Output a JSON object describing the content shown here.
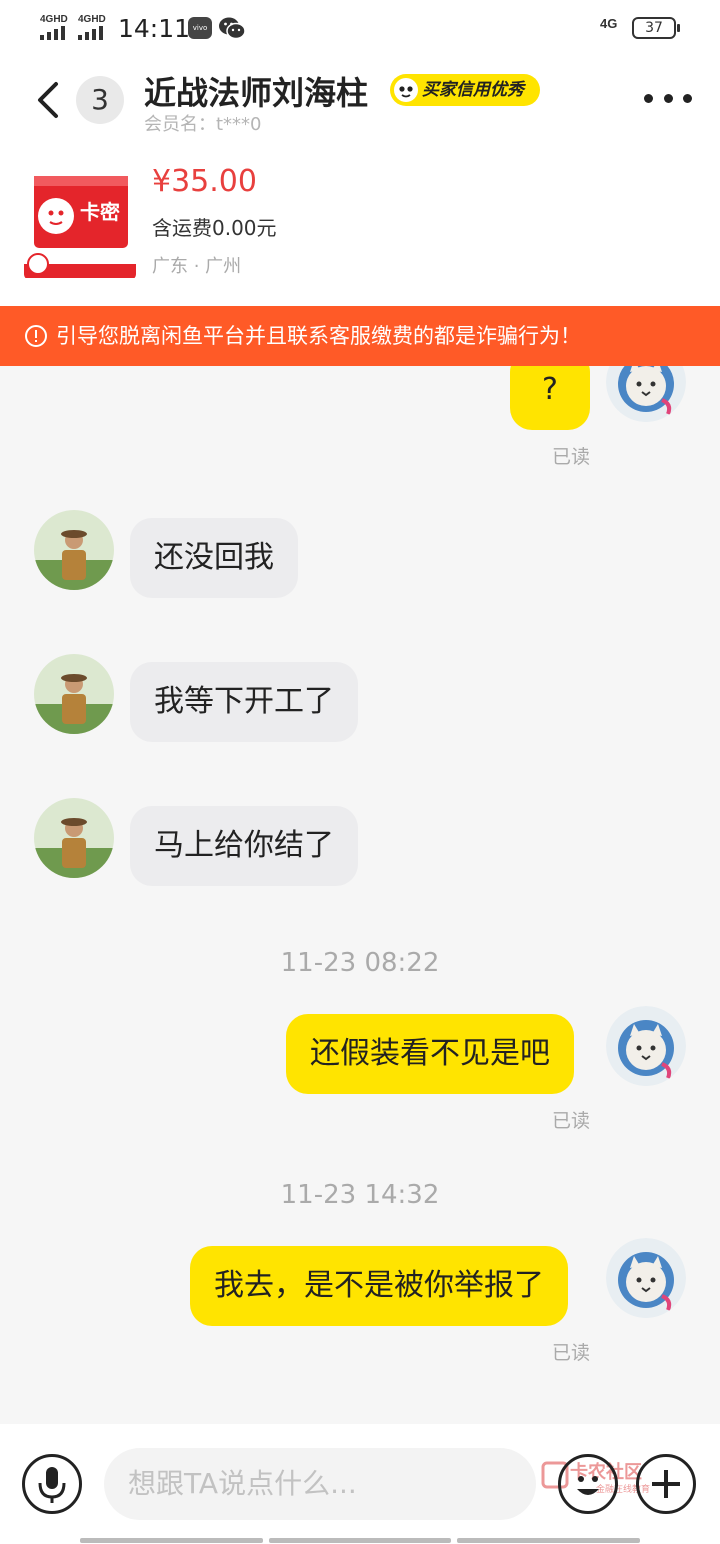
{
  "status_bar": {
    "signal_1": "4GHD",
    "signal_2": "4GHD",
    "time": "14:11",
    "network": "4G",
    "battery": "37"
  },
  "header": {
    "unread_count": "3",
    "title": "近战法师刘海柱",
    "credit_badge": "买家信用优秀",
    "member_name": "会员名：t***0"
  },
  "product": {
    "image_text": "卡密",
    "price": "¥35.00",
    "shipping": "含运费0.00元",
    "location": "广东 · 广州"
  },
  "warning": {
    "text": "引导您脱离闲鱼平台并且联系客服缴费的都是诈骗行为！"
  },
  "messages": {
    "m1": {
      "text": "?",
      "status": "已读"
    },
    "m2": {
      "text": "还没回我"
    },
    "m3": {
      "text": "我等下开工了"
    },
    "m4": {
      "text": "马上给你结了"
    },
    "t1": "11-23 08:22",
    "m5": {
      "text": "还假装看不见是吧",
      "status": "已读"
    },
    "t2": "11-23 14:32",
    "m6": {
      "text": "我去，是不是被你举报了",
      "status": "已读"
    }
  },
  "input": {
    "placeholder": "想跟TA说点什么..."
  },
  "watermark": {
    "line1": "卡农社区",
    "line2": "金融在线教育"
  },
  "colors": {
    "accent_yellow": "#ffe400",
    "warning_orange": "#ff5a27",
    "price_red": "#e8403e",
    "peer_bubble": "#ececee"
  }
}
